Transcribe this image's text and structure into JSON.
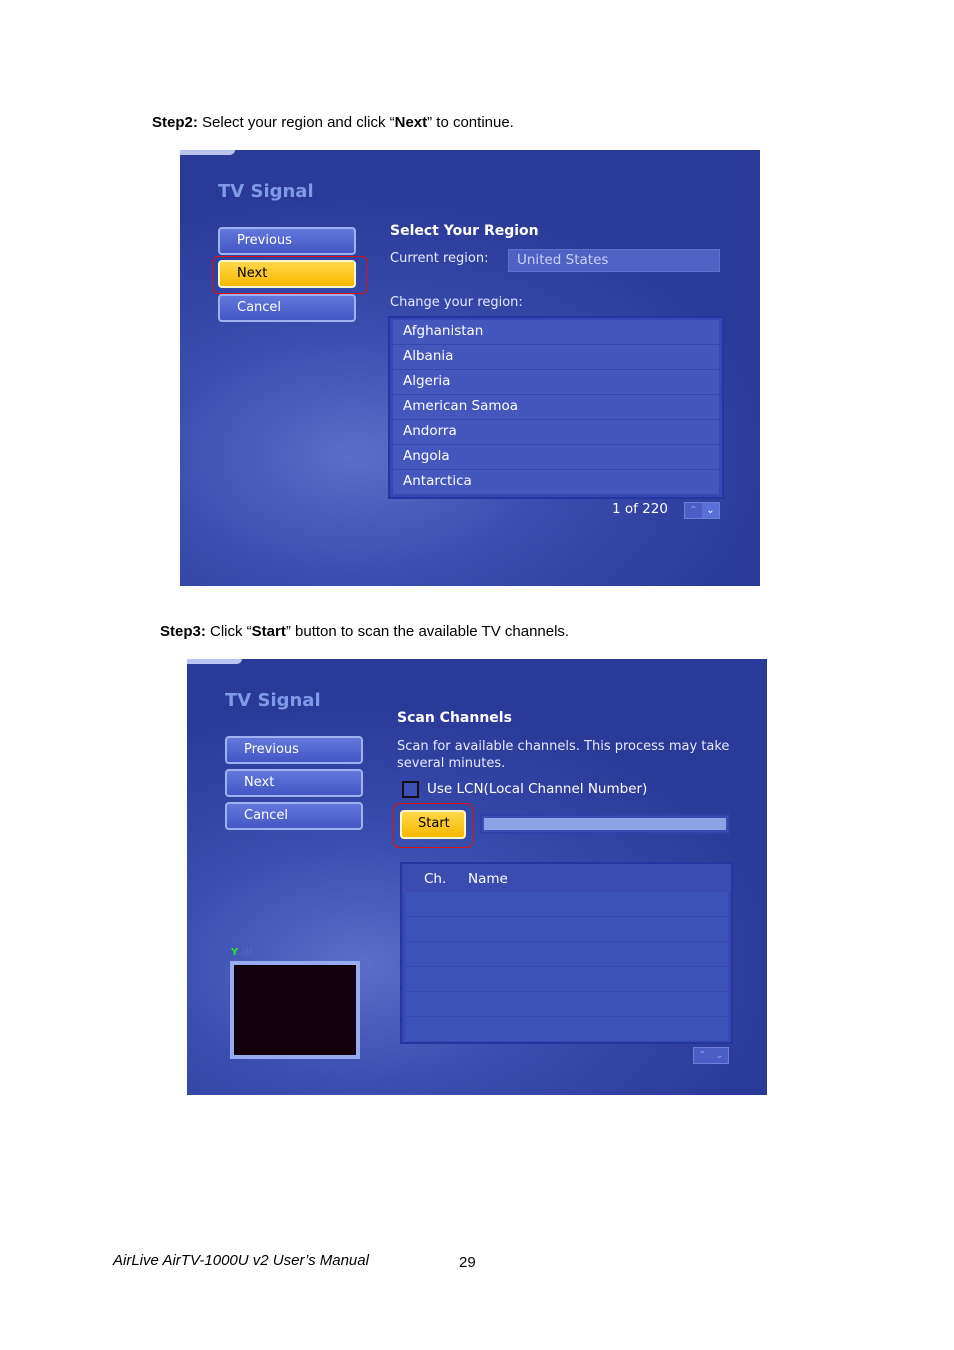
{
  "step2": {
    "bold": "Step2:",
    "text1": " Select your region and click “",
    "bold2": "Next",
    "text2": "” to continue."
  },
  "step3": {
    "bold": "Step3:",
    "text1": " Click “",
    "bold2": "Start",
    "text2": "” button to scan the available TV channels."
  },
  "region_screen": {
    "title": "TV Signal",
    "buttons": {
      "previous": "Previous",
      "next": "Next",
      "cancel": "Cancel"
    },
    "heading": "Select Your Region",
    "current_label": "Current region:",
    "current_value": "United States",
    "change_label": "Change your region:",
    "regions": [
      "Afghanistan",
      "Albania",
      "Algeria",
      "American Samoa",
      "Andorra",
      "Angola",
      "Antarctica"
    ],
    "pager": "1 of 220",
    "highlight_color": "#e01010"
  },
  "scan_screen": {
    "title": "TV Signal",
    "buttons": {
      "previous": "Previous",
      "next": "Next",
      "cancel": "Cancel",
      "start": "Start"
    },
    "heading": "Scan Channels",
    "description": "Scan for available channels. This process may take several minutes.",
    "lcn_label": "Use LCN(Local Channel Number)",
    "lcn_checked": false,
    "progress": 0,
    "columns": [
      "Ch.",
      "Name"
    ]
  },
  "footer": {
    "manual": "AirLive AirTV-1000U v2 User’s Manual",
    "page": "29"
  }
}
